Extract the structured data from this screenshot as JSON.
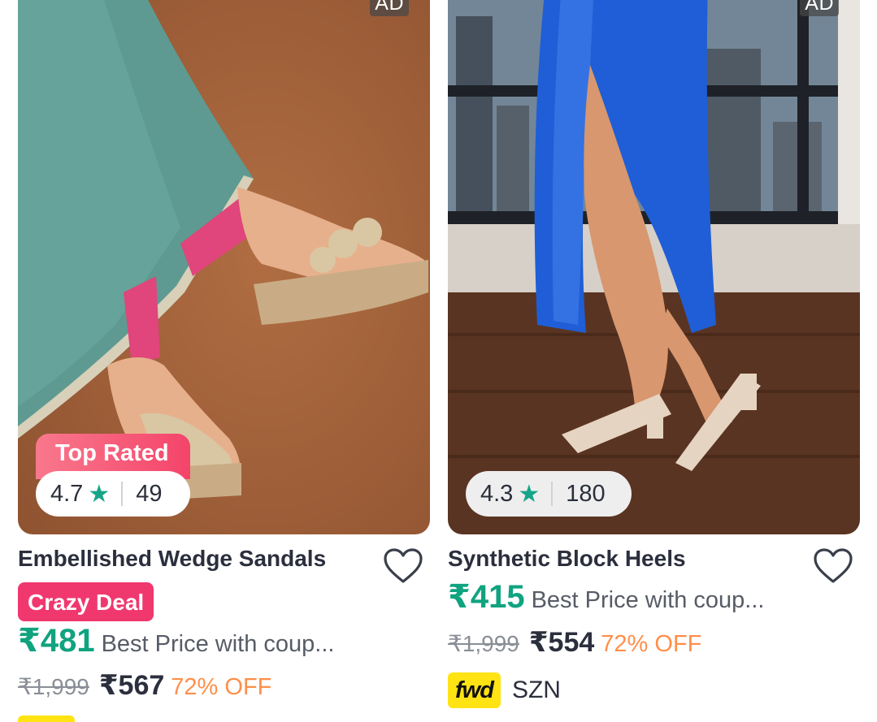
{
  "products": [
    {
      "ad_label": "AD",
      "top_rated_label": "Top Rated",
      "rating": "4.7",
      "rating_count": "49",
      "title": "Embellished Wedge Sandals",
      "deal_badge": "Crazy Deal",
      "best_price": "₹481",
      "coupon_text": "Best Price with coup...",
      "mrp": "₹1,999",
      "sale_price": "₹567",
      "discount": "72% OFF",
      "image_icon": "product-photo-wedge-sandals"
    },
    {
      "ad_label": "AD",
      "rating": "4.3",
      "rating_count": "180",
      "title": "Synthetic Block Heels",
      "best_price": "₹415",
      "coupon_text": "Best Price with coup...",
      "mrp": "₹1,999",
      "sale_price": "₹554",
      "discount": "72% OFF",
      "brand_badge": "fwd",
      "brand_name": "SZN",
      "image_icon": "product-photo-block-heels"
    }
  ],
  "colors": {
    "price_green": "#10a37f",
    "discount_orange": "#ff8f4a",
    "crazy_deal_pink": "#f0386f",
    "fwd_yellow": "#ffe313",
    "star_teal": "#17a589"
  }
}
